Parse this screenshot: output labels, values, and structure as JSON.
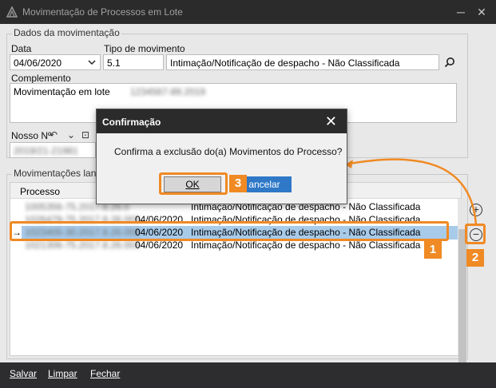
{
  "window": {
    "title": "Movimentação de Processos em Lote"
  },
  "form": {
    "group_title": "Dados da movimentação",
    "data_label": "Data",
    "data_value": "04/06/2020",
    "tipo_label": "Tipo de movimento",
    "tipo_code": "5.1",
    "tipo_desc": "Intimação/Notificação de despacho - Não Classificada",
    "complemento_label": "Complemento",
    "complemento_value": "Movimentação em lote",
    "complemento_blurred": "1234567-89.2019",
    "nosso_label": "Nosso Nº",
    "nosso_value": "2019/21-21981"
  },
  "grid": {
    "group_title": "Movimentações lanç",
    "col_processo": "Processo",
    "rows": [
      {
        "processo": "1005356-75.2017.8.26.0",
        "data": "",
        "mov": "Intimação/Notificação de despacho - Não Classificada"
      },
      {
        "processo": "1026479-75.2017.8.26.003",
        "data": "04/06/2020",
        "mov": "Intimação/Notificação de despacho - Não Classificada"
      },
      {
        "processo": "1023405-30.2017.8.26.003",
        "data": "04/06/2020",
        "mov": "Intimação/Notificação de despacho - Não Classificada"
      },
      {
        "processo": "1021306-75.2017.8.26.003",
        "data": "04/06/2020",
        "mov": "Intimação/Notificação de despacho - Não Classificada"
      }
    ]
  },
  "dialog": {
    "title": "Confirmação",
    "message": "Confirma a exclusão do(a) Movimentos do Processo?",
    "ok": "OK",
    "cancel": "ancelar"
  },
  "bottom": {
    "salvar": "Salvar",
    "limpar": "Limpar",
    "fechar": "Fechar"
  },
  "badges": {
    "b1": "1",
    "b2": "2",
    "b3": "3"
  },
  "colors": {
    "accent": "#f08a24",
    "selection": "#a8cbea",
    "primary_button": "#2e78c7"
  }
}
